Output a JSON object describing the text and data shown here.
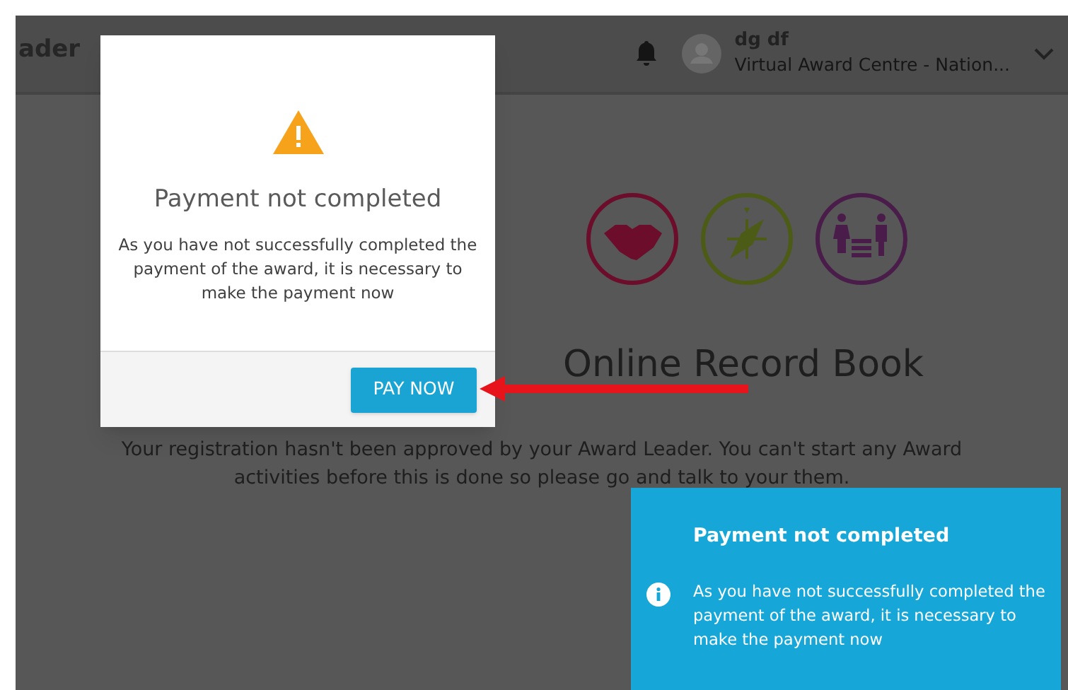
{
  "header": {
    "brand": "ader",
    "user_name": "dg df",
    "user_org": "Virtual Award Centre - Nation..."
  },
  "hero": {
    "title": "Online Record Book",
    "message": "Your registration hasn't been approved by your Award Leader. You can't start any Award activities before this is done so please go and talk to your them."
  },
  "modal": {
    "title": "Payment not completed",
    "message": "As you have not successfully completed the payment of the award, it is necessary to make the payment now",
    "button": "PAY NOW"
  },
  "toast": {
    "title": "Payment not completed",
    "message": "As you have not successfully completed the payment of the award, it is necessary to make the payment now"
  }
}
